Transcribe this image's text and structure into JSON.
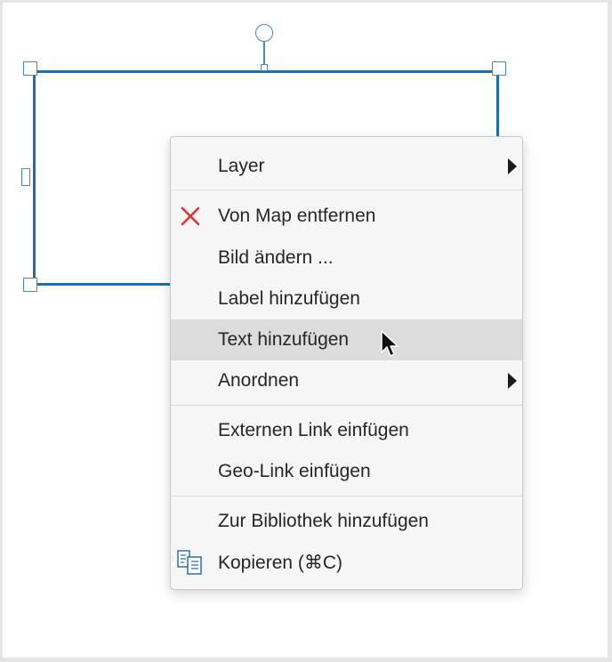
{
  "context_menu": {
    "items": [
      {
        "label": "Layer",
        "submenu": true
      },
      {
        "label": "Von Map entfernen",
        "icon": "remove-x-icon",
        "icon_color": "#e0332b"
      },
      {
        "label": "Bild ändern ..."
      },
      {
        "label": "Label hinzufügen"
      },
      {
        "label": "Text hinzufügen",
        "highlighted": true
      },
      {
        "label": "Anordnen",
        "submenu": true
      },
      {
        "label": "Externen Link einfügen"
      },
      {
        "label": "Geo-Link einfügen"
      },
      {
        "label": "Zur Bibliothek hinzufügen"
      },
      {
        "label": "Kopieren (⌘C)",
        "icon": "copy-icon"
      }
    ]
  },
  "colors": {
    "selection_border": "#1d6fb0",
    "menu_background": "#f6f6f6",
    "highlight": "#dcdcdc"
  }
}
